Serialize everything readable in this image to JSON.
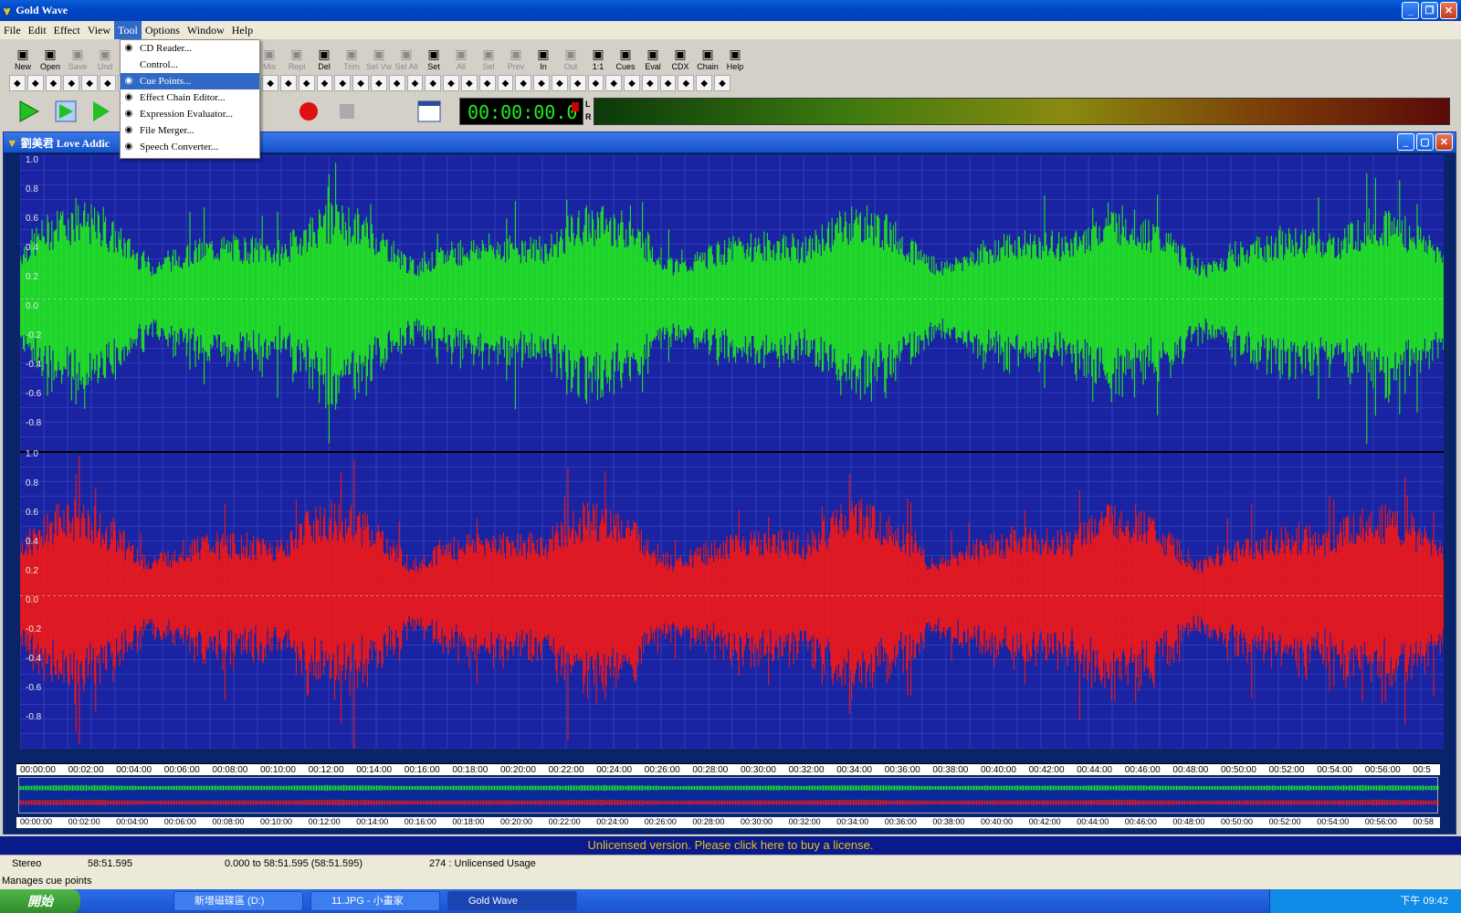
{
  "app": {
    "title": "Gold Wave",
    "doc_title": "劉美君 Love Addic"
  },
  "menubar": [
    "File",
    "Edit",
    "Effect",
    "View",
    "Tool",
    "Options",
    "Window",
    "Help"
  ],
  "tool_menu": [
    {
      "label": "CD Reader...",
      "icon": "cd-icon"
    },
    {
      "label": "Control...",
      "icon": ""
    },
    {
      "label": "Cue Points...",
      "icon": "cue-icon",
      "selected": true
    },
    {
      "label": "Effect Chain Editor...",
      "icon": "chain-icon"
    },
    {
      "label": "Expression Evaluator...",
      "icon": "fx-icon"
    },
    {
      "label": "File Merger...",
      "icon": "merge-icon"
    },
    {
      "label": "Speech Converter...",
      "icon": "speech-icon"
    }
  ],
  "toolbar": [
    {
      "label": "New",
      "enabled": true
    },
    {
      "label": "Open",
      "enabled": true
    },
    {
      "label": "Save",
      "enabled": false
    },
    {
      "label": "Und",
      "enabled": false
    },
    {
      "label": "Mix",
      "enabled": false
    },
    {
      "label": "Repl",
      "enabled": false
    },
    {
      "label": "Del",
      "enabled": true
    },
    {
      "label": "Trim",
      "enabled": false
    },
    {
      "label": "Sel Vw",
      "enabled": false
    },
    {
      "label": "Sel All",
      "enabled": false
    },
    {
      "label": "Set",
      "enabled": true
    },
    {
      "label": "All",
      "enabled": false
    },
    {
      "label": "Sel",
      "enabled": false
    },
    {
      "label": "Prev",
      "enabled": false
    },
    {
      "label": "In",
      "enabled": true
    },
    {
      "label": "Out",
      "enabled": false
    },
    {
      "label": "1:1",
      "enabled": true
    },
    {
      "label": "Cues",
      "enabled": true
    },
    {
      "label": "Eval",
      "enabled": true
    },
    {
      "label": "CDX",
      "enabled": true
    },
    {
      "label": "Chain",
      "enabled": true
    },
    {
      "label": "Help",
      "enabled": true
    }
  ],
  "time_display": "00:00:00.0",
  "meter_labels": [
    "L",
    "R"
  ],
  "y_axis": [
    "1.0",
    "0.8",
    "0.6",
    "0.4",
    "0.2",
    "0.0",
    "-0.2",
    "-0.4",
    "-0.6",
    "-0.8"
  ],
  "timeline": [
    "00:00:00",
    "00:02:00",
    "00:04:00",
    "00:06:00",
    "00:08:00",
    "00:10:00",
    "00:12:00",
    "00:14:00",
    "00:16:00",
    "00:18:00",
    "00:20:00",
    "00:22:00",
    "00:24:00",
    "00:26:00",
    "00:28:00",
    "00:30:00",
    "00:32:00",
    "00:34:00",
    "00:36:00",
    "00:38:00",
    "00:40:00",
    "00:42:00",
    "00:44:00",
    "00:46:00",
    "00:48:00",
    "00:50:00",
    "00:52:00",
    "00:54:00",
    "00:56:00",
    "00:5"
  ],
  "timeline2_last": "00:58",
  "license_banner": "Unlicensed version. Please click here to buy a license.",
  "status": {
    "channels": "Stereo",
    "length": "58:51.595",
    "selection": "0.000 to 58:51.595 (58:51.595)",
    "usage": "274 : Unlicensed Usage"
  },
  "hint": "Manages cue points",
  "taskbar": {
    "start": "開始",
    "tasks": [
      "新增磁碟區 (D:)",
      "11.JPG - 小畫家",
      "Gold Wave"
    ],
    "clock": "下午 09:42"
  },
  "colors": {
    "left_channel": "#21e621",
    "right_channel": "#f01818",
    "wave_bg": "#1a23a2",
    "grid": "#3d55c8"
  }
}
